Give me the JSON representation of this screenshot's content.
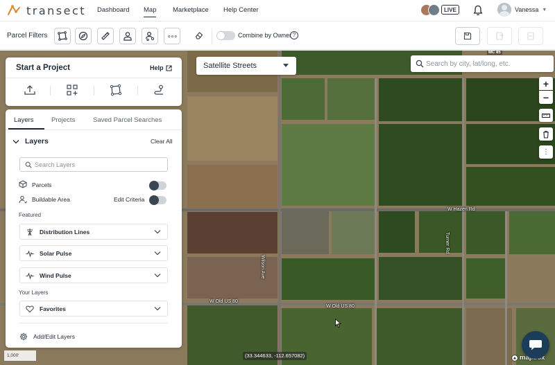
{
  "brand": {
    "logo_text": "transect"
  },
  "nav": {
    "links": [
      "Dashboard",
      "Map",
      "Marketplace",
      "Help Center"
    ],
    "active": "Map",
    "live_badge": "LIVE",
    "user_name": "Vanessa"
  },
  "toolbar": {
    "parcel_filters_label": "Parcel Filters",
    "filter_icons": [
      "draw-polygon-icon",
      "compass-icon",
      "ruler-icon",
      "owner-icon",
      "user-network-icon",
      "more-icon"
    ],
    "combine_by_owner_label": "Combine by Owner",
    "combine_by_owner_on": false,
    "help_glyph": "?",
    "more_glyph": "∘∘∘"
  },
  "map": {
    "style_select_value": "Satellite Streets",
    "search_placeholder": "Search by city, lat/long, etc.",
    "zoom_in": "+",
    "zoom_out": "−",
    "road_labels": [
      "W Hazen Rd",
      "W Old US 80",
      "W Old US 80",
      "Wilson Ave",
      "Turner Rd",
      "MC 85"
    ],
    "scale": "1,000'",
    "coordinates": "(33.344633, -112.657082)",
    "attribution": "mapbox"
  },
  "project_card": {
    "title": "Start a Project",
    "help_label": "Help",
    "actions": [
      "upload-icon",
      "add-grid-icon",
      "draw-polygon-icon",
      "route-icon"
    ]
  },
  "panel": {
    "tabs": [
      "Layers",
      "Projects",
      "Saved Parcel Searches"
    ],
    "active_tab": "Layers",
    "layers_heading": "Layers",
    "clear_all": "Clear All",
    "search_placeholder": "Search Layers",
    "rows": [
      {
        "label": "Parcels",
        "on": false
      },
      {
        "label": "Buildable Area",
        "on": false,
        "extra": "Edit Criteria"
      }
    ],
    "featured_heading": "Featured",
    "featured": [
      {
        "label": "Distribution Lines",
        "icon": "power-pole-icon"
      },
      {
        "label": "Solar Pulse",
        "icon": "pulse-icon"
      },
      {
        "label": "Wind Pulse",
        "icon": "pulse-icon"
      }
    ],
    "your_layers_heading": "Your Layers",
    "your_layers": [
      {
        "label": "Favorites",
        "icon": "heart-icon"
      }
    ],
    "add_edit_label": "Add/Edit Layers"
  }
}
